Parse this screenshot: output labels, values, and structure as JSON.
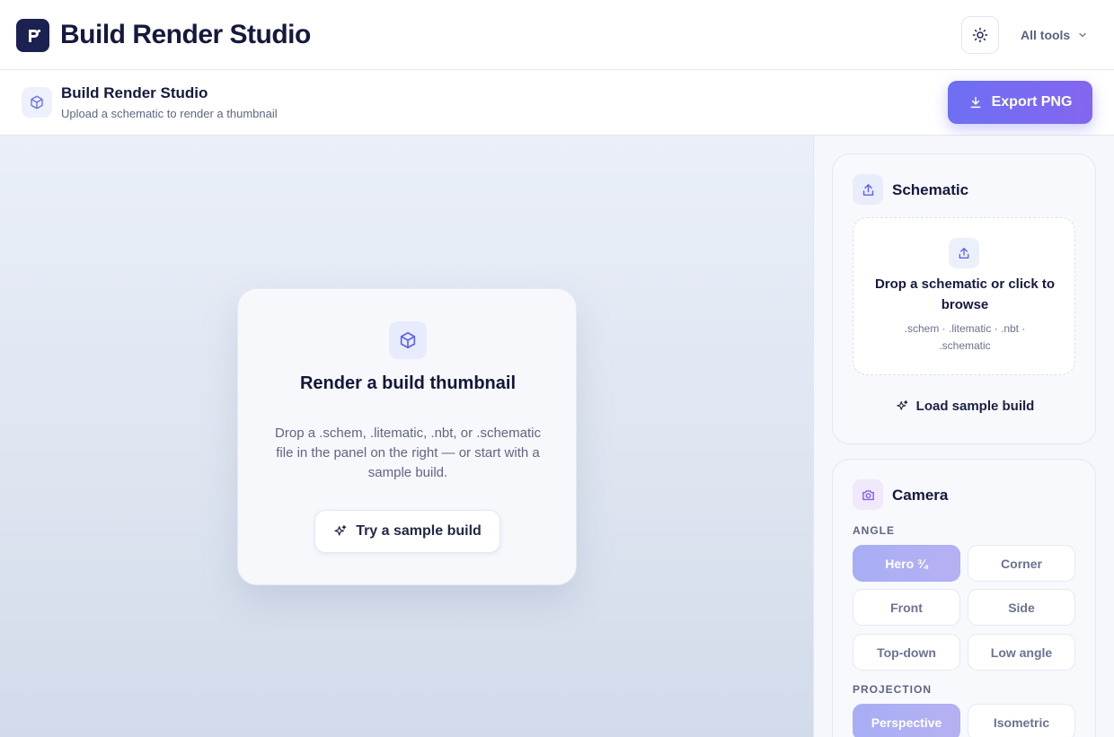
{
  "app": {
    "brand": "Build Render Studio",
    "logo_letter": "P",
    "tools_label": "All tools"
  },
  "subheader": {
    "title": "Build Render Studio",
    "caption": "Upload a schematic to render a thumbnail",
    "export_label": "Export PNG"
  },
  "canvas": {
    "title": "Render a build thumbnail",
    "description": "Drop a .schem, .litematic, .nbt, or .schematic file in the panel on the right — or start with a sample build.",
    "sample_button": "Try a sample build"
  },
  "schematic_panel": {
    "title": "Schematic",
    "dropzone_title": "Drop a schematic or click to browse",
    "dropzone_formats": ".schem · .litematic · .nbt · .schematic",
    "load_sample": "Load sample build"
  },
  "camera_panel": {
    "title": "Camera",
    "angle_label": "ANGLE",
    "angles": [
      "Hero ¾",
      "Corner",
      "Front",
      "Side",
      "Top-down",
      "Low angle"
    ],
    "angle_selected": "Hero ¾",
    "projection_label": "PROJECTION",
    "projections": [
      "Perspective",
      "Isometric"
    ],
    "projection_selected": "Perspective"
  },
  "colors": {
    "accent": "#6d6ff2",
    "accent_end": "#8466f0",
    "selected_option": "#a7aef4",
    "brand_dark": "#1b2150"
  },
  "icons": {
    "logo": "p-logo-icon",
    "theme": "sun-icon",
    "tools": "chevron-down-icon",
    "subheader": "cube-icon",
    "export": "download-icon",
    "empty_state": "cube-icon",
    "sample": "sparkles-icon",
    "schematic": "upload-icon",
    "camera": "camera-icon"
  }
}
